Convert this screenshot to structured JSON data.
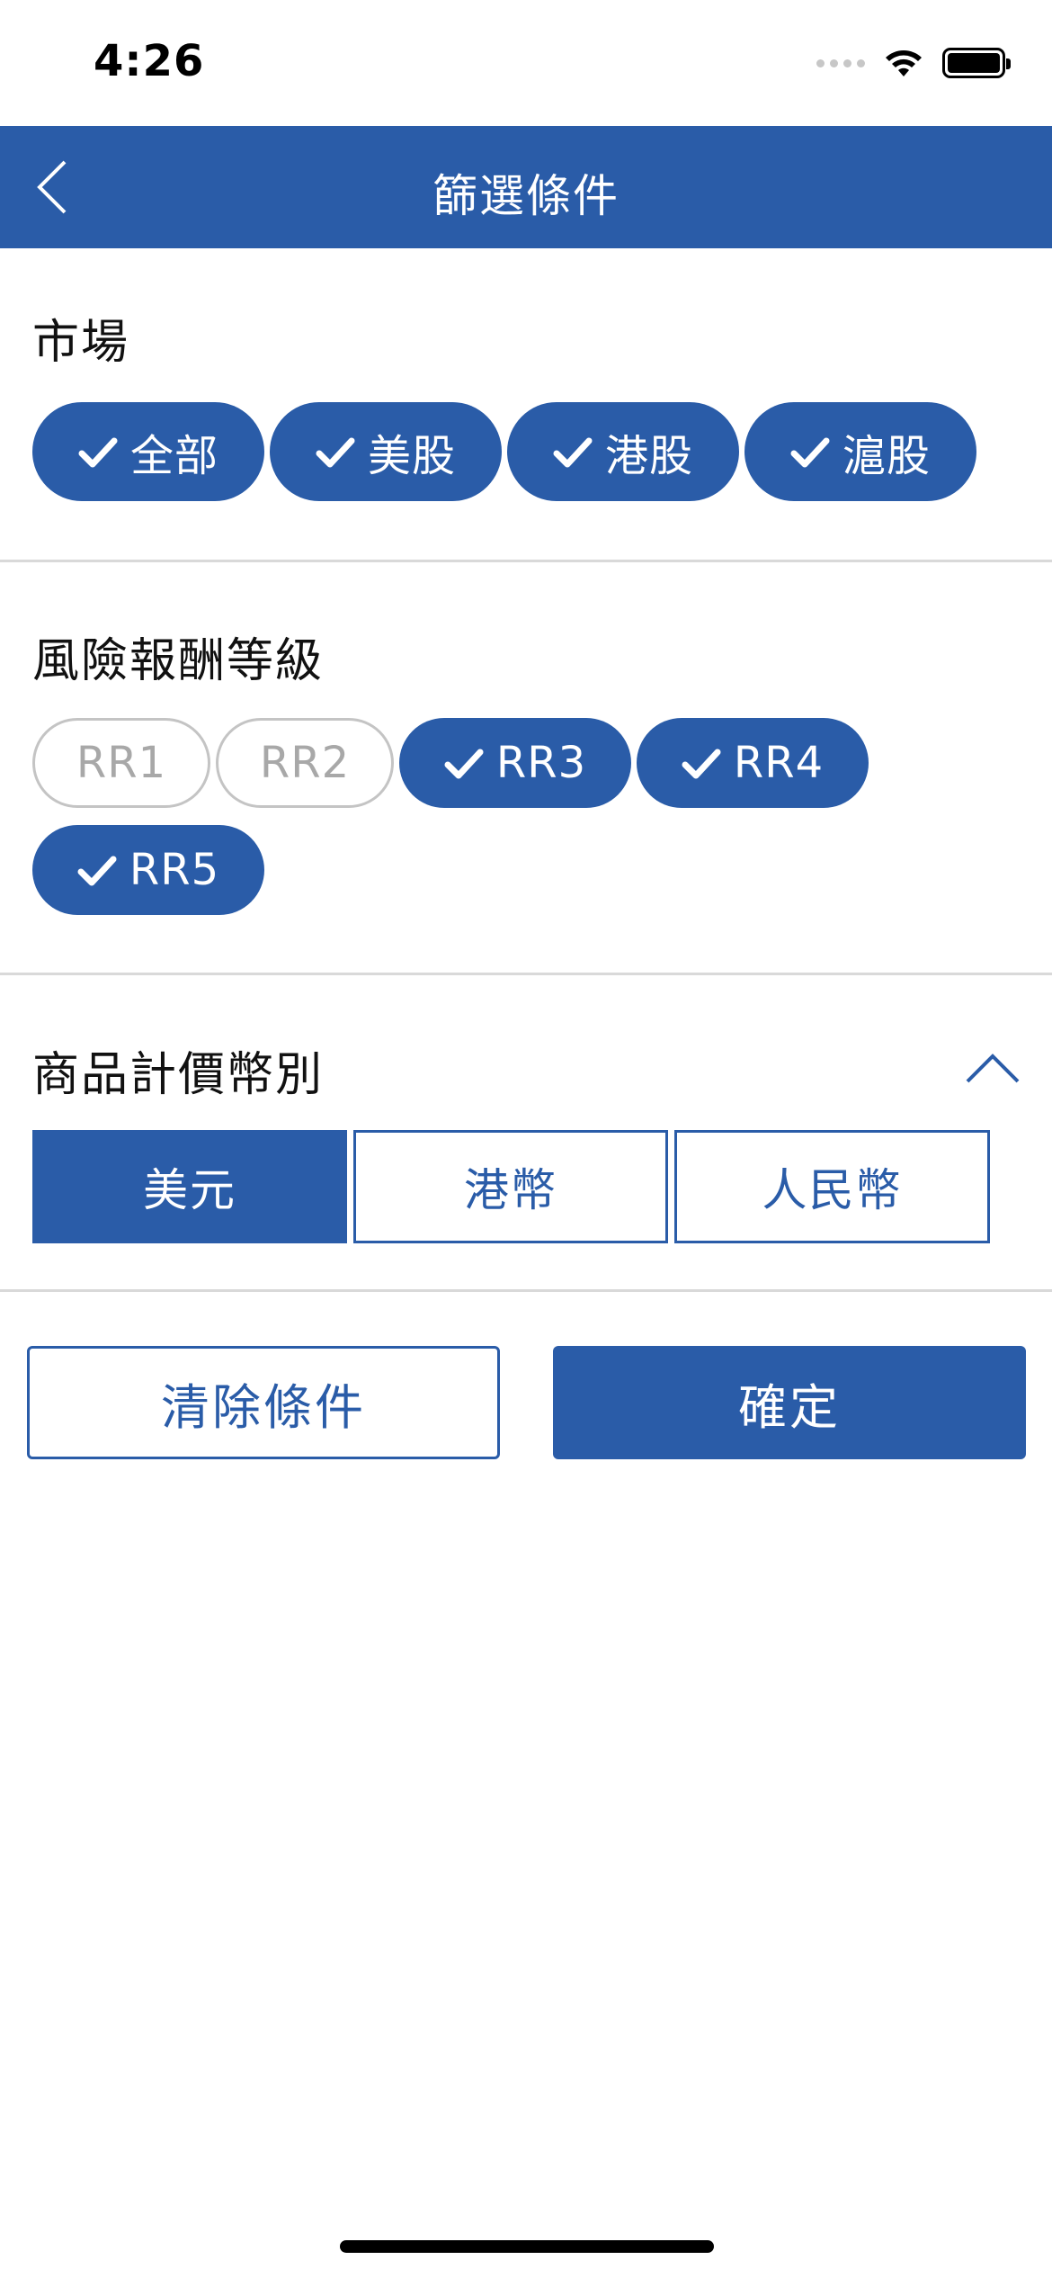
{
  "status_bar": {
    "time": "4:26"
  },
  "header": {
    "title": "篩選條件"
  },
  "market": {
    "title": "市場",
    "options": [
      {
        "label": "全部",
        "selected": true
      },
      {
        "label": "美股",
        "selected": true
      },
      {
        "label": "港股",
        "selected": true
      },
      {
        "label": "滬股",
        "selected": true
      }
    ]
  },
  "risk": {
    "title": "風險報酬等級",
    "options": [
      {
        "label": "RR1",
        "selected": false
      },
      {
        "label": "RR2",
        "selected": false
      },
      {
        "label": "RR3",
        "selected": true
      },
      {
        "label": "RR4",
        "selected": true
      },
      {
        "label": "RR5",
        "selected": true
      }
    ]
  },
  "currency": {
    "title": "商品計價幣別",
    "options": [
      {
        "label": "美元",
        "selected": true
      },
      {
        "label": "港幣",
        "selected": false
      },
      {
        "label": "人民幣",
        "selected": false
      }
    ]
  },
  "actions": {
    "clear_label": "清除條件",
    "confirm_label": "確定"
  },
  "colors": {
    "accent": "#2a5ca8",
    "divider": "#d9d9d9",
    "unselected_text": "#a8a8a8"
  },
  "icons": {
    "back": "chevron-left-icon",
    "check": "check-icon",
    "collapse": "chevron-up-icon"
  }
}
